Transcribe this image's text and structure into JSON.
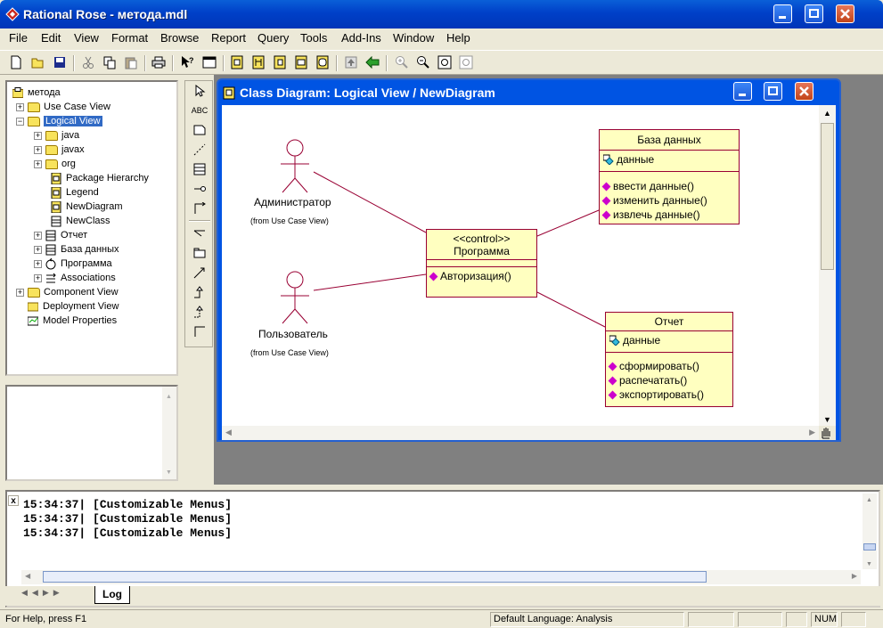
{
  "app": {
    "title": "Rational Rose - метода.mdl",
    "minimize": "0",
    "restore": "1",
    "close": "r"
  },
  "menu": [
    "File",
    "Edit",
    "View",
    "Format",
    "Browse",
    "Report",
    "Query",
    "Tools",
    "Add-Ins",
    "Window",
    "Help"
  ],
  "tree": {
    "root": "метода",
    "use_case_view": "Use Case View",
    "logical_view": "Logical View",
    "java": "java",
    "javax": "javax",
    "org": "org",
    "package_hierarchy": "Package Hierarchy",
    "legend": "Legend",
    "new_diagram": "NewDiagram",
    "new_class": "NewClass",
    "otchet": "Отчет",
    "baza": "База данных",
    "programma": "Программа",
    "associations": "Associations",
    "component_view": "Component View",
    "deployment_view": "Deployment View",
    "model_properties": "Model Properties"
  },
  "toolbox": {
    "text_tool": "ABC"
  },
  "diagram": {
    "title": "Class Diagram: Logical View / NewDiagram",
    "actor_admin": "Администратор",
    "actor_admin_from": "(from Use Case View)",
    "actor_user": "Пользователь",
    "actor_user_from": "(from Use Case View)",
    "control": {
      "stereotype": "<<control>>",
      "name": "Программа",
      "op1": "Авторизация()"
    },
    "db": {
      "name": "База данных",
      "attr1": "данные",
      "op1": "ввести данные()",
      "op2": "изменить данные()",
      "op3": "извлечь данные()"
    },
    "report": {
      "name": "Отчет",
      "attr1": "данные",
      "op1": "сформировать()",
      "op2": "распечатать()",
      "op3": "экспортировать()"
    }
  },
  "log": {
    "lines": [
      "15:34:37|  [Customizable Menus]",
      "15:34:37|  [Customizable Menus]",
      "15:34:37|  [Customizable Menus]"
    ],
    "tab": "Log",
    "close": "x"
  },
  "status": {
    "help": "For Help, press F1",
    "language": "Default Language: Analysis",
    "num": "NUM"
  }
}
